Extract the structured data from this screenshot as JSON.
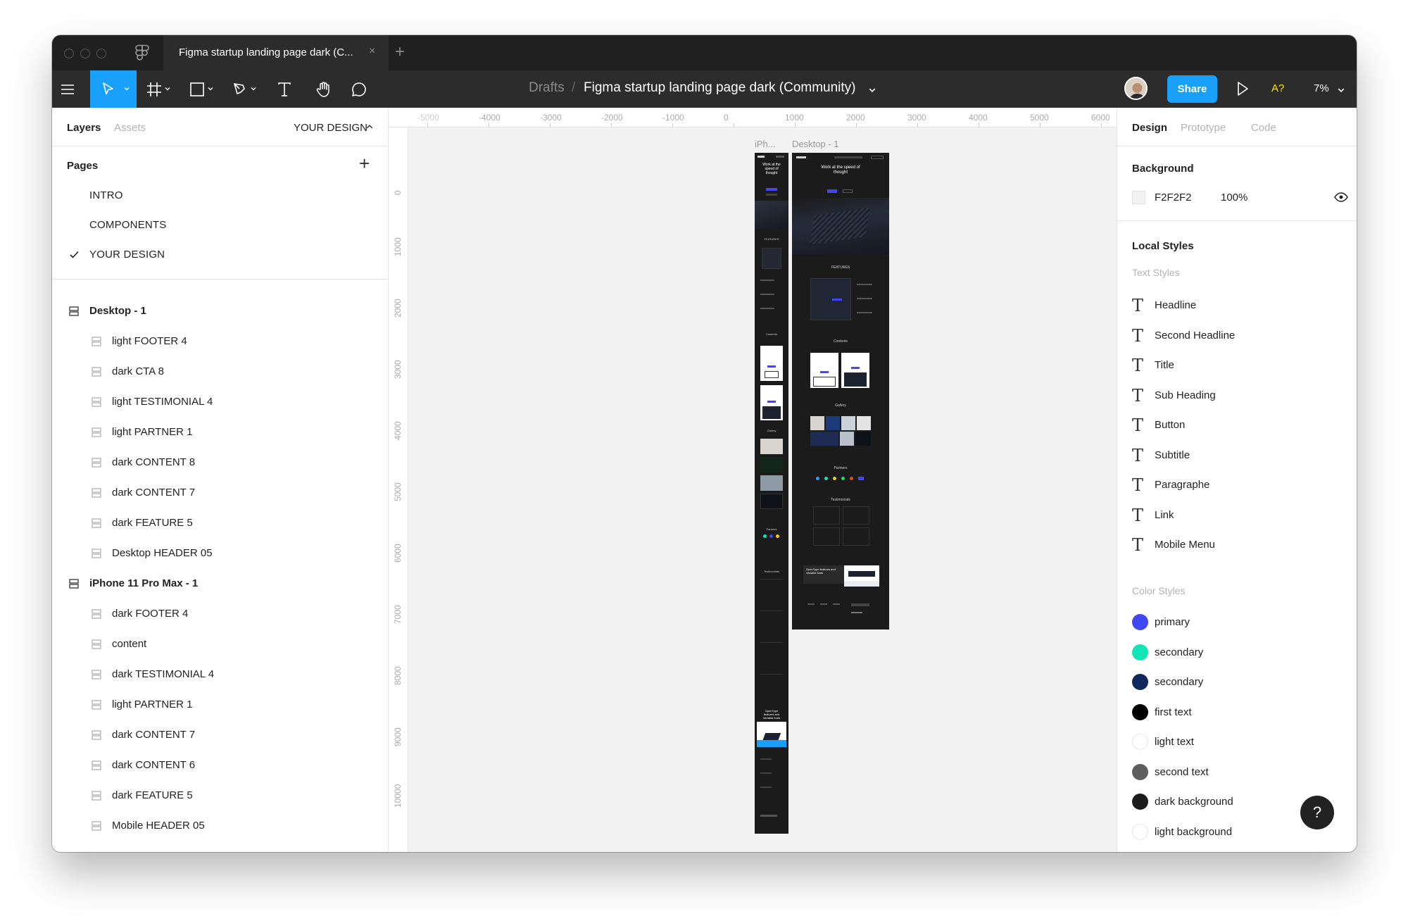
{
  "window": {
    "tab_title": "Figma startup landing page dark (C...",
    "tab_close": "×",
    "tab_new": "+"
  },
  "toolbar": {
    "breadcrumb_root": "Drafts",
    "breadcrumb_sep": "/",
    "file_name": "Figma startup landing page dark (Community)",
    "share_label": "Share",
    "spell_label": "A?",
    "zoom_label": "7%",
    "tools": [
      "menu-icon",
      "move-tool-icon",
      "frame-tool-icon",
      "shape-tool-icon",
      "pen-tool-icon",
      "text-tool-icon",
      "hand-tool-icon",
      "comment-tool-icon"
    ],
    "accent": "#18a0fb"
  },
  "left_panel": {
    "tabs": [
      "Layers",
      "Assets"
    ],
    "current_page_menu": "YOUR DESIGN",
    "pages_heading": "Pages",
    "pages_add": "+",
    "pages": [
      {
        "label": "INTRO",
        "selected": false
      },
      {
        "label": "COMPONENTS",
        "selected": false
      },
      {
        "label": "YOUR DESIGN",
        "selected": true
      }
    ],
    "frames": [
      {
        "name": "Desktop - 1",
        "children": [
          "light FOOTER 4",
          "dark CTA 8",
          "light TESTIMONIAL 4",
          "light PARTNER 1",
          "dark CONTENT 8",
          "dark CONTENT 7",
          "dark FEATURE 5",
          "Desktop HEADER 05"
        ]
      },
      {
        "name": "iPhone 11 Pro Max - 1",
        "children": [
          "dark FOOTER 4",
          "content",
          "dark TESTIMONIAL 4",
          "light PARTNER 1",
          "dark CONTENT 7",
          "dark CONTENT 6",
          "dark FEATURE 5",
          "Mobile HEADER 05"
        ]
      }
    ]
  },
  "canvas": {
    "ruler_x": [
      "-5000",
      "-4000",
      "-3000",
      "-2000",
      "-1000",
      "0",
      "1000",
      "2000",
      "3000",
      "4000",
      "5000",
      "6000"
    ],
    "ruler_y": [
      "0",
      "1000",
      "2000",
      "3000",
      "4000",
      "5000",
      "6000",
      "7000",
      "8000",
      "9000",
      "10000",
      "00"
    ],
    "frame_labels": {
      "mobile": "iPh...",
      "desktop": "Desktop - 1"
    },
    "desktop_hero": "Work at the speed of thought",
    "mobile_hero": "Work at the speed of thought",
    "section_labels": {
      "features": "FEATURES",
      "contents": "Contents",
      "gallery": "Gallery",
      "partners": "Partners",
      "testimonials": "Testimonials",
      "cta": "OpenType features and Variable fonts"
    }
  },
  "right_panel": {
    "tabs": [
      "Design",
      "Prototype",
      "Code"
    ],
    "background_heading": "Background",
    "background_hex": "F2F2F2",
    "background_opacity": "100%",
    "local_styles_heading": "Local Styles",
    "text_styles_heading": "Text Styles",
    "text_styles": [
      "Headline",
      "Second Headline",
      "Title",
      "Sub Heading",
      "Button",
      "Subtitle",
      "Paragraphe",
      "Link",
      "Mobile Menu"
    ],
    "color_styles_heading": "Color Styles",
    "color_styles": [
      {
        "name": "primary",
        "color": "#4147f5"
      },
      {
        "name": "secondary",
        "color": "#12e4b5"
      },
      {
        "name": "secondary",
        "color": "#10285a"
      },
      {
        "name": "first text",
        "color": "#000000"
      },
      {
        "name": "light text",
        "color": "#ffffff"
      },
      {
        "name": "second text",
        "color": "#5e5e5e"
      },
      {
        "name": "dark background",
        "color": "#1c1c1c"
      },
      {
        "name": "light background",
        "color": "#ffffff"
      }
    ],
    "text_style_glyph": "T"
  },
  "help": {
    "label": "?"
  }
}
